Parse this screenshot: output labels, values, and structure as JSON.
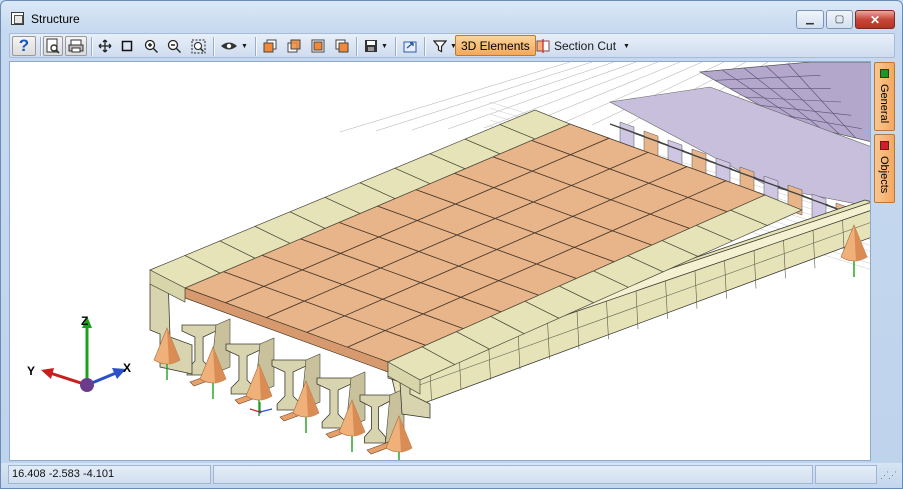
{
  "window": {
    "title": "Structure"
  },
  "toolbar": {
    "help_glyph": "?",
    "elements_3d_label": "3D Elements",
    "section_cut_label": "Section Cut"
  },
  "side_tabs": [
    {
      "label": "General",
      "color": "#1a9a1a"
    },
    {
      "label": "Objects",
      "color": "#d22020"
    }
  ],
  "axes": {
    "z": "Z",
    "y": "Y",
    "x": "X"
  },
  "status": {
    "coordinates": "16.408  -2.583  -4.101",
    "cell2": "",
    "cell3": ""
  },
  "colors": {
    "deck_tile": "#e8b48a",
    "rail": "#e6e3b8",
    "girder": "#d9d4b0",
    "support": "#efb07a",
    "far_panel": "#b3a8cc",
    "accent": "#f4a85a"
  }
}
